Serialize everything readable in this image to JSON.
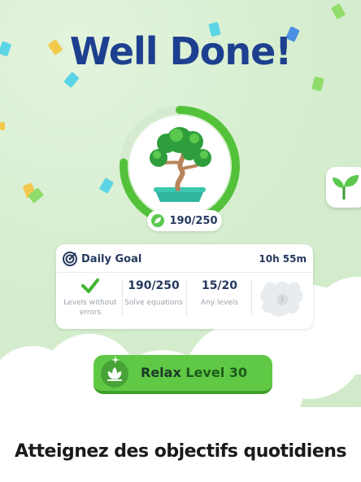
{
  "header": {
    "title": "Well Done!"
  },
  "tree": {
    "progress_text": "190/250",
    "progress_fraction": 0.76
  },
  "daily_goal": {
    "label": "Daily Goal",
    "timer": "10h 55m",
    "goals": [
      {
        "value": "",
        "caption": "Levels without errors",
        "completed": true
      },
      {
        "value": "190/250",
        "caption": "Solve equations",
        "completed": false
      },
      {
        "value": "15/20",
        "caption": "Any levels",
        "completed": false
      }
    ]
  },
  "play_button": {
    "word": "Relax",
    "level_word": "Level",
    "level_number": "30"
  },
  "footer": {
    "caption": "Atteignez des objectifs quotidiens"
  },
  "colors": {
    "accent_green": "#5fc845",
    "title_blue": "#1d3f8f",
    "ring_green": "#53c23a"
  }
}
